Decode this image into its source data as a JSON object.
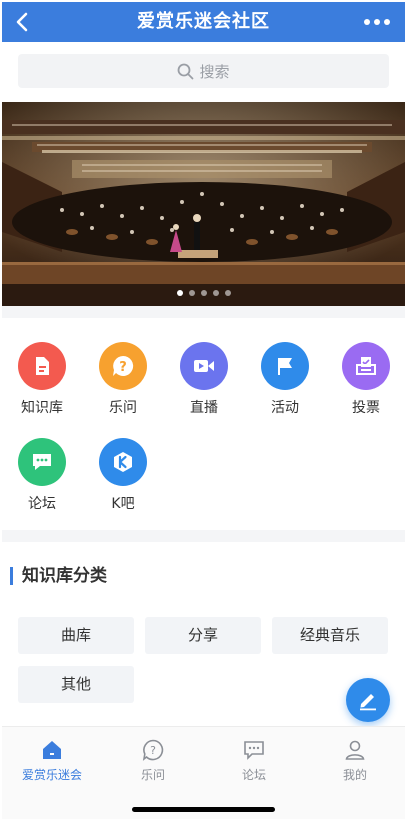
{
  "header": {
    "title": "爱赏乐迷会社区",
    "back_icon": "chevron-left-icon",
    "more_icon": "more-dots-icon",
    "background": "#3b7ddd"
  },
  "search": {
    "placeholder": "搜索",
    "icon": "search-icon"
  },
  "banner": {
    "image": "orchestra-concert-hall-photo",
    "slides": 5,
    "active_slide": 1
  },
  "grid": {
    "items": [
      {
        "label": "知识库",
        "icon": "document-icon",
        "color": "#f35a4f"
      },
      {
        "label": "乐问",
        "icon": "question-bubble-icon",
        "color": "#f7a12f"
      },
      {
        "label": "直播",
        "icon": "video-camera-icon",
        "color": "#6b74ee"
      },
      {
        "label": "活动",
        "icon": "flag-icon",
        "color": "#2f8bea"
      },
      {
        "label": "投票",
        "icon": "ballot-box-icon",
        "color": "#9a6bf2"
      },
      {
        "label": "论坛",
        "icon": "chat-bubble-icon",
        "color": "#2ec37b"
      },
      {
        "label": "K吧",
        "icon": "k-hexagon-icon",
        "color": "#2f8bea"
      }
    ]
  },
  "category": {
    "title": "知识库分类",
    "chips": [
      "曲库",
      "分享",
      "经典音乐",
      "其他"
    ]
  },
  "fab": {
    "icon": "pencil-icon",
    "color": "#2f8bea"
  },
  "tabbar": {
    "tabs": [
      {
        "label": "爱赏乐迷会",
        "icon": "home-icon",
        "active": true
      },
      {
        "label": "乐问",
        "icon": "question-circle-icon",
        "active": false
      },
      {
        "label": "论坛",
        "icon": "forum-icon",
        "active": false
      },
      {
        "label": "我的",
        "icon": "person-icon",
        "active": false
      }
    ],
    "active_color": "#3b7ddd"
  }
}
